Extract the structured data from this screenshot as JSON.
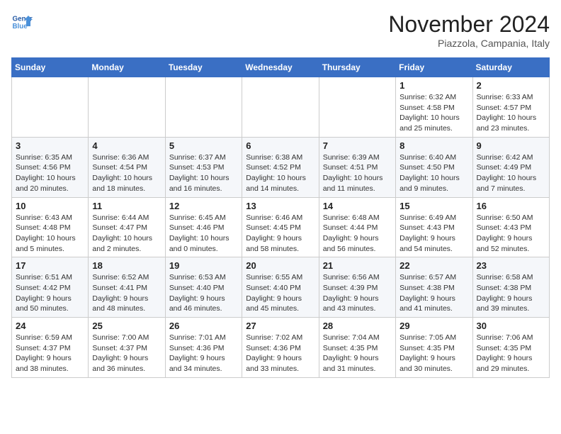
{
  "header": {
    "logo_line1": "General",
    "logo_line2": "Blue",
    "month": "November 2024",
    "location": "Piazzola, Campania, Italy"
  },
  "weekdays": [
    "Sunday",
    "Monday",
    "Tuesday",
    "Wednesday",
    "Thursday",
    "Friday",
    "Saturday"
  ],
  "weeks": [
    [
      {
        "day": "",
        "info": ""
      },
      {
        "day": "",
        "info": ""
      },
      {
        "day": "",
        "info": ""
      },
      {
        "day": "",
        "info": ""
      },
      {
        "day": "",
        "info": ""
      },
      {
        "day": "1",
        "info": "Sunrise: 6:32 AM\nSunset: 4:58 PM\nDaylight: 10 hours and 25 minutes."
      },
      {
        "day": "2",
        "info": "Sunrise: 6:33 AM\nSunset: 4:57 PM\nDaylight: 10 hours and 23 minutes."
      }
    ],
    [
      {
        "day": "3",
        "info": "Sunrise: 6:35 AM\nSunset: 4:56 PM\nDaylight: 10 hours and 20 minutes."
      },
      {
        "day": "4",
        "info": "Sunrise: 6:36 AM\nSunset: 4:54 PM\nDaylight: 10 hours and 18 minutes."
      },
      {
        "day": "5",
        "info": "Sunrise: 6:37 AM\nSunset: 4:53 PM\nDaylight: 10 hours and 16 minutes."
      },
      {
        "day": "6",
        "info": "Sunrise: 6:38 AM\nSunset: 4:52 PM\nDaylight: 10 hours and 14 minutes."
      },
      {
        "day": "7",
        "info": "Sunrise: 6:39 AM\nSunset: 4:51 PM\nDaylight: 10 hours and 11 minutes."
      },
      {
        "day": "8",
        "info": "Sunrise: 6:40 AM\nSunset: 4:50 PM\nDaylight: 10 hours and 9 minutes."
      },
      {
        "day": "9",
        "info": "Sunrise: 6:42 AM\nSunset: 4:49 PM\nDaylight: 10 hours and 7 minutes."
      }
    ],
    [
      {
        "day": "10",
        "info": "Sunrise: 6:43 AM\nSunset: 4:48 PM\nDaylight: 10 hours and 5 minutes."
      },
      {
        "day": "11",
        "info": "Sunrise: 6:44 AM\nSunset: 4:47 PM\nDaylight: 10 hours and 2 minutes."
      },
      {
        "day": "12",
        "info": "Sunrise: 6:45 AM\nSunset: 4:46 PM\nDaylight: 10 hours and 0 minutes."
      },
      {
        "day": "13",
        "info": "Sunrise: 6:46 AM\nSunset: 4:45 PM\nDaylight: 9 hours and 58 minutes."
      },
      {
        "day": "14",
        "info": "Sunrise: 6:48 AM\nSunset: 4:44 PM\nDaylight: 9 hours and 56 minutes."
      },
      {
        "day": "15",
        "info": "Sunrise: 6:49 AM\nSunset: 4:43 PM\nDaylight: 9 hours and 54 minutes."
      },
      {
        "day": "16",
        "info": "Sunrise: 6:50 AM\nSunset: 4:43 PM\nDaylight: 9 hours and 52 minutes."
      }
    ],
    [
      {
        "day": "17",
        "info": "Sunrise: 6:51 AM\nSunset: 4:42 PM\nDaylight: 9 hours and 50 minutes."
      },
      {
        "day": "18",
        "info": "Sunrise: 6:52 AM\nSunset: 4:41 PM\nDaylight: 9 hours and 48 minutes."
      },
      {
        "day": "19",
        "info": "Sunrise: 6:53 AM\nSunset: 4:40 PM\nDaylight: 9 hours and 46 minutes."
      },
      {
        "day": "20",
        "info": "Sunrise: 6:55 AM\nSunset: 4:40 PM\nDaylight: 9 hours and 45 minutes."
      },
      {
        "day": "21",
        "info": "Sunrise: 6:56 AM\nSunset: 4:39 PM\nDaylight: 9 hours and 43 minutes."
      },
      {
        "day": "22",
        "info": "Sunrise: 6:57 AM\nSunset: 4:38 PM\nDaylight: 9 hours and 41 minutes."
      },
      {
        "day": "23",
        "info": "Sunrise: 6:58 AM\nSunset: 4:38 PM\nDaylight: 9 hours and 39 minutes."
      }
    ],
    [
      {
        "day": "24",
        "info": "Sunrise: 6:59 AM\nSunset: 4:37 PM\nDaylight: 9 hours and 38 minutes."
      },
      {
        "day": "25",
        "info": "Sunrise: 7:00 AM\nSunset: 4:37 PM\nDaylight: 9 hours and 36 minutes."
      },
      {
        "day": "26",
        "info": "Sunrise: 7:01 AM\nSunset: 4:36 PM\nDaylight: 9 hours and 34 minutes."
      },
      {
        "day": "27",
        "info": "Sunrise: 7:02 AM\nSunset: 4:36 PM\nDaylight: 9 hours and 33 minutes."
      },
      {
        "day": "28",
        "info": "Sunrise: 7:04 AM\nSunset: 4:35 PM\nDaylight: 9 hours and 31 minutes."
      },
      {
        "day": "29",
        "info": "Sunrise: 7:05 AM\nSunset: 4:35 PM\nDaylight: 9 hours and 30 minutes."
      },
      {
        "day": "30",
        "info": "Sunrise: 7:06 AM\nSunset: 4:35 PM\nDaylight: 9 hours and 29 minutes."
      }
    ]
  ]
}
